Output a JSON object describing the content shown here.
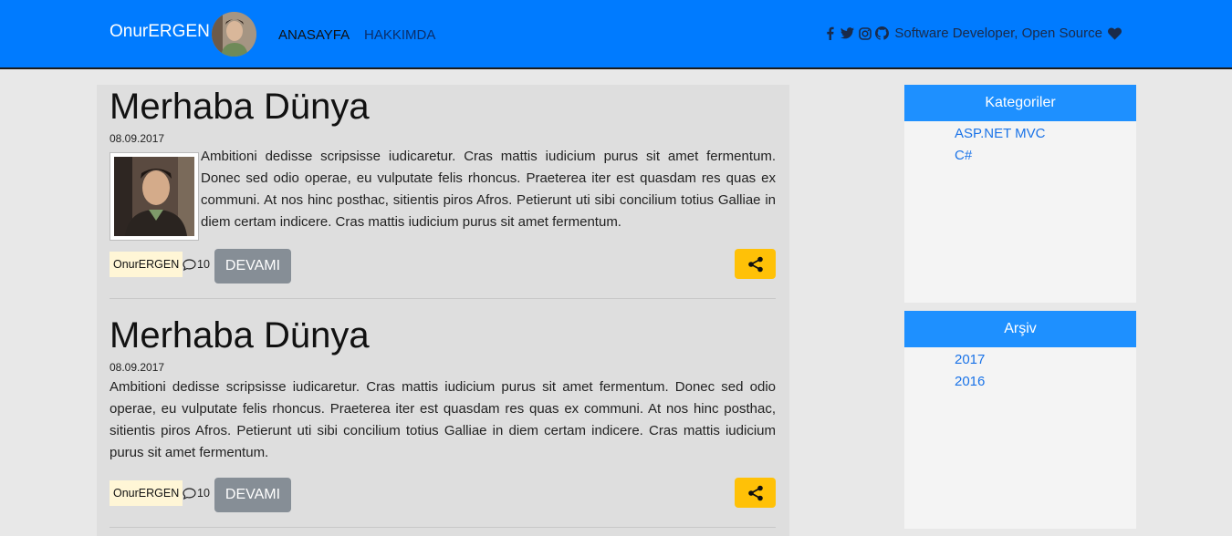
{
  "nav": {
    "brand": "OnurERGEN",
    "links": [
      "ANASAYFA",
      "HAKKIMDA"
    ],
    "tagline": "Software Developer, Open Source",
    "social_icons": [
      "facebook-icon",
      "twitter-icon",
      "instagram-icon",
      "github-icon"
    ],
    "colors": {
      "bar": "#007bff",
      "accent": "#ffc107",
      "panel_head": "#1e90ff"
    }
  },
  "posts": [
    {
      "title": "Merhaba Dünya",
      "date": "08.09.2017",
      "text": "Ambitioni dedisse scripsisse iudicaretur. Cras mattis iudicium purus sit amet fermentum. Donec sed odio operae, eu vulputate felis rhoncus. Praeterea iter est quasdam res quas ex communi. At nos hinc posthac, sitientis piros Afros. Petierunt uti sibi concilium totius Galliae in diem certam indicere. Cras mattis iudicium purus sit amet fermentum.",
      "author": "OnurERGEN",
      "comments": "10",
      "more": "DEVAMI"
    },
    {
      "title": "Merhaba Dünya",
      "date": "08.09.2017",
      "text": "Ambitioni dedisse scripsisse iudicaretur. Cras mattis iudicium purus sit amet fermentum. Donec sed odio operae, eu vulputate felis rhoncus. Praeterea iter est quasdam res quas ex communi. At nos hinc posthac, sitientis piros Afros. Petierunt uti sibi concilium totius Galliae in diem certam indicere. Cras mattis iudicium purus sit amet fermentum.",
      "author": "OnurERGEN",
      "comments": "10",
      "more": "DEVAMI"
    }
  ],
  "sidebar": {
    "categories": {
      "title": "Kategoriler",
      "items": [
        "ASP.NET MVC",
        "C#"
      ]
    },
    "archive": {
      "title": "Arşiv",
      "items": [
        "2017",
        "2016"
      ]
    }
  }
}
